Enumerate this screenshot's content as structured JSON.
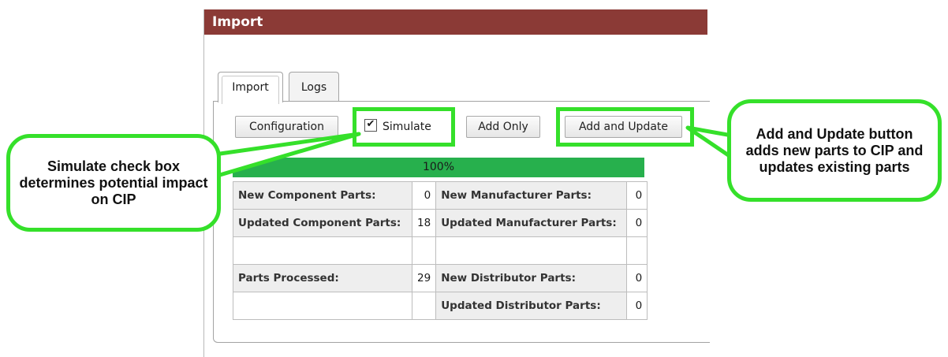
{
  "panel": {
    "title": "Import"
  },
  "tabs": [
    {
      "label": "Import",
      "active": true
    },
    {
      "label": "Logs",
      "active": false
    }
  ],
  "toolbar": {
    "configuration_label": "Configuration",
    "simulate_label": "Simulate",
    "simulate_checked": true,
    "add_only_label": "Add Only",
    "add_update_label": "Add and Update"
  },
  "progress": {
    "value": 1.0,
    "text": "100%"
  },
  "stats": {
    "rows": [
      {
        "label1": "New Component Parts:",
        "value1": "0",
        "label2": "New Manufacturer Parts:",
        "value2": "0"
      },
      {
        "label1": "Updated Component Parts:",
        "value1": "18",
        "label2": "Updated Manufacturer Parts:",
        "value2": "0"
      },
      {
        "label1": "",
        "value1": "",
        "label2": "",
        "value2": ""
      },
      {
        "label1": "Parts Processed:",
        "value1": "29",
        "label2": "New Distributor Parts:",
        "value2": "0"
      },
      {
        "label1": "",
        "value1": "",
        "label2": "Updated Distributor Parts:",
        "value2": "0"
      }
    ]
  },
  "callouts": {
    "simulate": "Simulate check box determines potential impact on CIP",
    "add_update": "Add and Update button adds new parts to CIP and updates existing parts"
  },
  "colors": {
    "header": "#8b3a36",
    "progress": "#27b04d",
    "callout_border": "#35e02a"
  }
}
